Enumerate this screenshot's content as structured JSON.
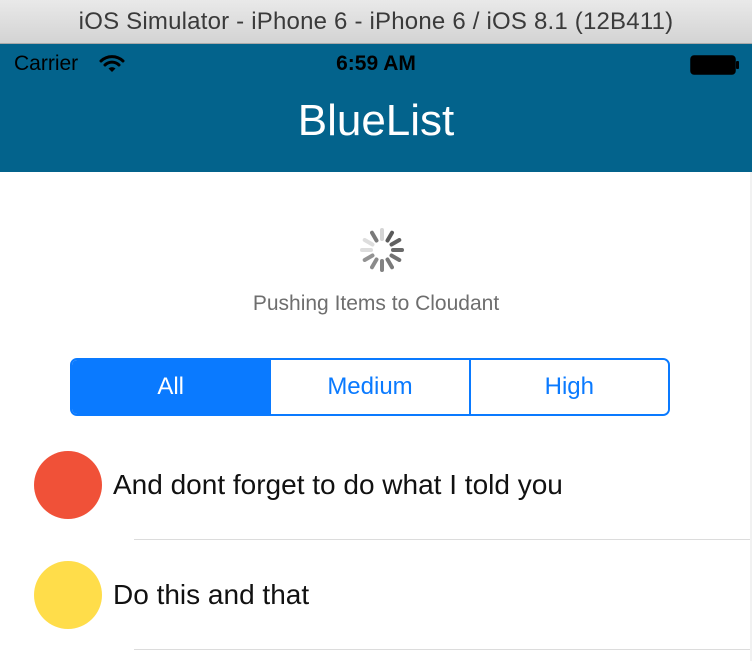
{
  "window": {
    "title": "iOS Simulator - iPhone 6 - iPhone 6 / iOS 8.1 (12B411)"
  },
  "status_bar": {
    "carrier": "Carrier",
    "time": "6:59 AM",
    "wifi_icon": "wifi-icon",
    "battery_icon": "battery-icon"
  },
  "nav_bar": {
    "title": "BlueList",
    "background_color": "#03638c"
  },
  "sync": {
    "activity_icon": "spinner-icon",
    "status_text": "Pushing Items to Cloudant"
  },
  "filter": {
    "segments": [
      "All",
      "Medium",
      "High"
    ],
    "selected": "All",
    "accent_color": "#0a7aff"
  },
  "items": [
    {
      "text": "And dont forget to do what I told you",
      "priority_color": "#f05138"
    },
    {
      "text": "Do this and that",
      "priority_color": "#ffdd4a"
    }
  ]
}
